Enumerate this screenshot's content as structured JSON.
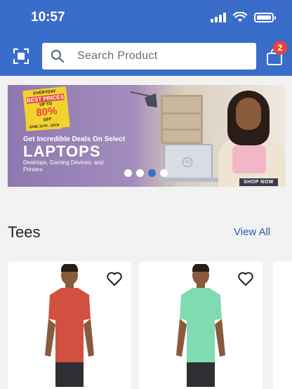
{
  "status_bar": {
    "time": "10:57"
  },
  "header": {
    "search_placeholder": "Search Product",
    "cart_count": "2",
    "icons": {
      "scan": "scan-icon",
      "search": "search-icon",
      "cart": "shopping-bag-icon"
    },
    "colors": {
      "bar": "#3a6cc9",
      "badge": "#e8453a"
    }
  },
  "banner": {
    "badge_line1": "EVERYDAY",
    "badge_line2": "BEST PRICES",
    "badge_line3": "UP TO",
    "badge_percent": "80%",
    "badge_off": "OFF",
    "date_range": "JUNE 11TH - 20TH",
    "headline": "Get Incredible Deals On Select",
    "title": "LAPTOPS",
    "subtitle": "Desktops, Gaming Devices, and Printers",
    "brand_mark": "hp",
    "cta": "SHOP NOW",
    "carousel_active_index": 2,
    "carousel_count": 4
  },
  "section": {
    "title": "Tees",
    "view_all": "View All"
  },
  "products": [
    {
      "shirt_color": "#d2503f",
      "icon": "heart-icon"
    },
    {
      "shirt_color": "#7fdcb0",
      "icon": "heart-icon"
    }
  ]
}
